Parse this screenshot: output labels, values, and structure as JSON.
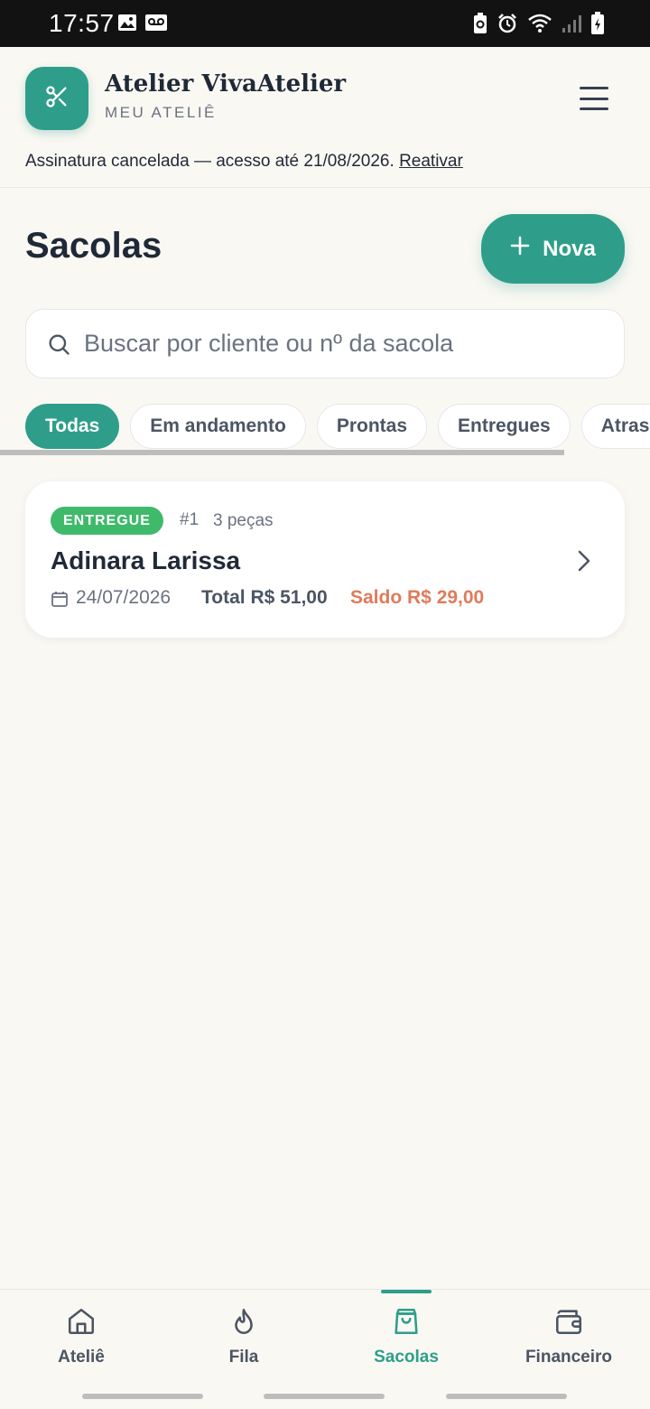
{
  "status_bar": {
    "time": "17:57",
    "left_icons": [
      "image-icon",
      "voicemail-icon"
    ],
    "right_icons": [
      "battery-saver-icon",
      "alarm-icon",
      "wifi-icon",
      "signal-icon",
      "battery-charging-icon"
    ]
  },
  "header": {
    "brand_name": "Atelier VivaAtelier",
    "brand_subtitle": "MEU ATELIÊ",
    "logo_icon": "scissors-icon",
    "menu_icon": "hamburger-menu-icon",
    "notice_text": "Assinatura cancelada — acesso até 21/08/2026.",
    "notice_link": "Reativar"
  },
  "page": {
    "title": "Sacolas",
    "new_button_label": "Nova"
  },
  "search": {
    "placeholder": "Buscar por cliente ou nº da sacola",
    "value": ""
  },
  "filters": [
    {
      "label": "Todas",
      "active": true
    },
    {
      "label": "Em andamento",
      "active": false
    },
    {
      "label": "Prontas",
      "active": false
    },
    {
      "label": "Entregues",
      "active": false
    },
    {
      "label": "Atrasadas",
      "active": false
    }
  ],
  "bags": [
    {
      "status": "ENTREGUE",
      "number": "#1",
      "pieces": "3 peças",
      "client": "Adinara Larissa",
      "date": "24/07/2026",
      "total": "Total R$ 51,00",
      "balance": "Saldo R$ 29,00"
    }
  ],
  "bottom_nav": [
    {
      "label": "Ateliê",
      "icon": "home-icon",
      "active": false
    },
    {
      "label": "Fila",
      "icon": "flame-icon",
      "active": false
    },
    {
      "label": "Sacolas",
      "icon": "shopping-bag-icon",
      "active": true
    },
    {
      "label": "Financeiro",
      "icon": "wallet-icon",
      "active": false
    }
  ],
  "colors": {
    "accent": "#2e9e8a",
    "background": "#faf8f3",
    "badge_delivered": "#3fba6b",
    "balance": "#e07b5a",
    "text_primary": "#1f2937"
  }
}
